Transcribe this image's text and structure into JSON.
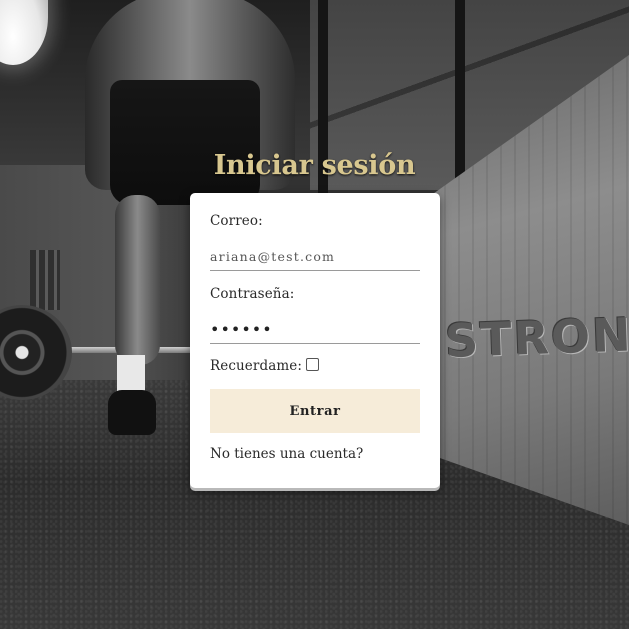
{
  "background": {
    "painted_text": "STRONG"
  },
  "login": {
    "title": "Iniciar sesión",
    "email_label": "Correo:",
    "email_value": "ariana@test.com",
    "password_label": "Contraseña:",
    "password_value": "••••••",
    "remember_label": "Recuerdame:",
    "remember_checked": false,
    "submit_label": "Entrar",
    "signup_link": "No tienes una cuenta?"
  },
  "colors": {
    "title": "#d8c78f",
    "card_background": "#ffffff",
    "button_background": "#f6ecd9",
    "text": "#2a2a2a"
  }
}
